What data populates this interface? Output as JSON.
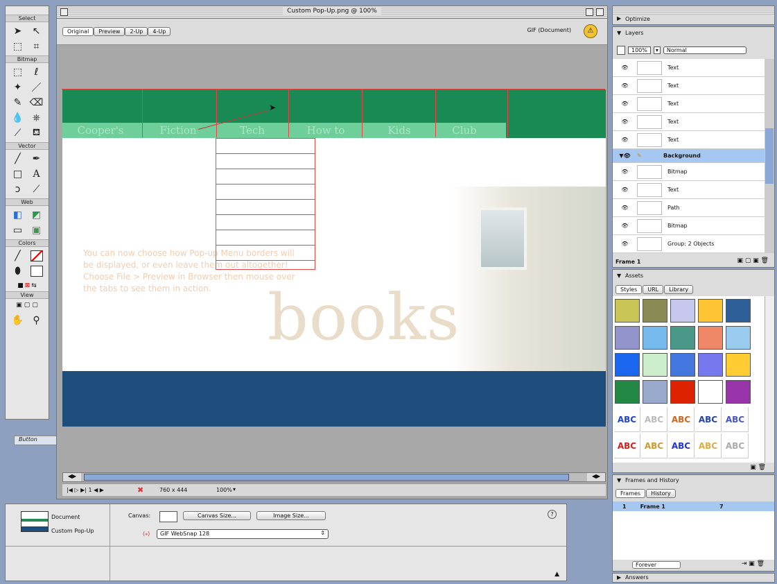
{
  "toolbox": {
    "sections": {
      "select": "Select",
      "bitmap": "Bitmap",
      "vector": "Vector",
      "web": "Web",
      "colors": "Colors",
      "view": "View"
    }
  },
  "document_window": {
    "title": "Custom Pop-Up.png @ 100%",
    "tabs": [
      "Original",
      "Preview",
      "2-Up",
      "4-Up"
    ],
    "format": "GIF (Document)"
  },
  "canvas": {
    "nav_tabs": [
      "Cooper's",
      "Fiction",
      "Tech",
      "How to",
      "Kids",
      "Club"
    ],
    "info_lines": [
      "You can now choose how Pop-up Menu borders will",
      "be displayed, or even leave them out altogether!",
      "Choose File > Preview in Browser then mouse over",
      "the tabs to see them in action."
    ],
    "big_word": "books",
    "colors": {
      "green": "#1a8a55",
      "light_green": "#6ecf9a",
      "blue": "#1f4e7c"
    }
  },
  "status_bar": {
    "size": "760 x 444",
    "zoom": "100%"
  },
  "background_label": "Button",
  "property_inspector": {
    "doc_label": "Document",
    "doc_name": "Custom Pop-Up",
    "canvas_label": "Canvas:",
    "canvas_size_button": "Canvas Size...",
    "image_size_button": "Image Size...",
    "palette_label": "GIF WebSnap 128",
    "help": "?"
  },
  "right_panels": {
    "optimize_title": "Optimize",
    "layers": {
      "title": "Layers",
      "opacity": "100%",
      "blend": "Normal",
      "items": [
        {
          "name": "Text"
        },
        {
          "name": "Text"
        },
        {
          "name": "Text"
        },
        {
          "name": "Text"
        },
        {
          "name": "Text"
        },
        {
          "name": "Background"
        },
        {
          "name": "Bitmap"
        },
        {
          "name": "Text"
        },
        {
          "name": "Path"
        },
        {
          "name": "Bitmap"
        },
        {
          "name": "Group: 2 Objects"
        }
      ],
      "frame": "Frame 1"
    },
    "assets": {
      "title": "Assets",
      "tabs": [
        "Styles",
        "URL",
        "Library"
      ],
      "swatches": [
        "#c8c455",
        "#8a8a55",
        "#c8c8ee",
        "#ffc433",
        "#2e5f99",
        "#9494cc",
        "#77bbee",
        "#4a9988",
        "#ee8866",
        "#99ccee",
        "#1a66ee",
        "#cceecc",
        "#4477dd",
        "#7777ee",
        "#ffcc33",
        "#228844",
        "#99aacc",
        "#dd2200",
        "#ffffff",
        "#9933aa"
      ],
      "style_labels": [
        "ABC",
        "ABC",
        "ABC",
        "ABC",
        "ABC",
        "ABC",
        "ABC",
        "ABC",
        "ABC",
        "ABC"
      ]
    },
    "frames": {
      "title": "Frames and History",
      "tabs": [
        "Frames",
        "History"
      ],
      "frame_num": "1",
      "frame_name": "Frame 1",
      "frame_delay": "7",
      "loop": "Forever"
    },
    "answers_title": "Answers"
  }
}
